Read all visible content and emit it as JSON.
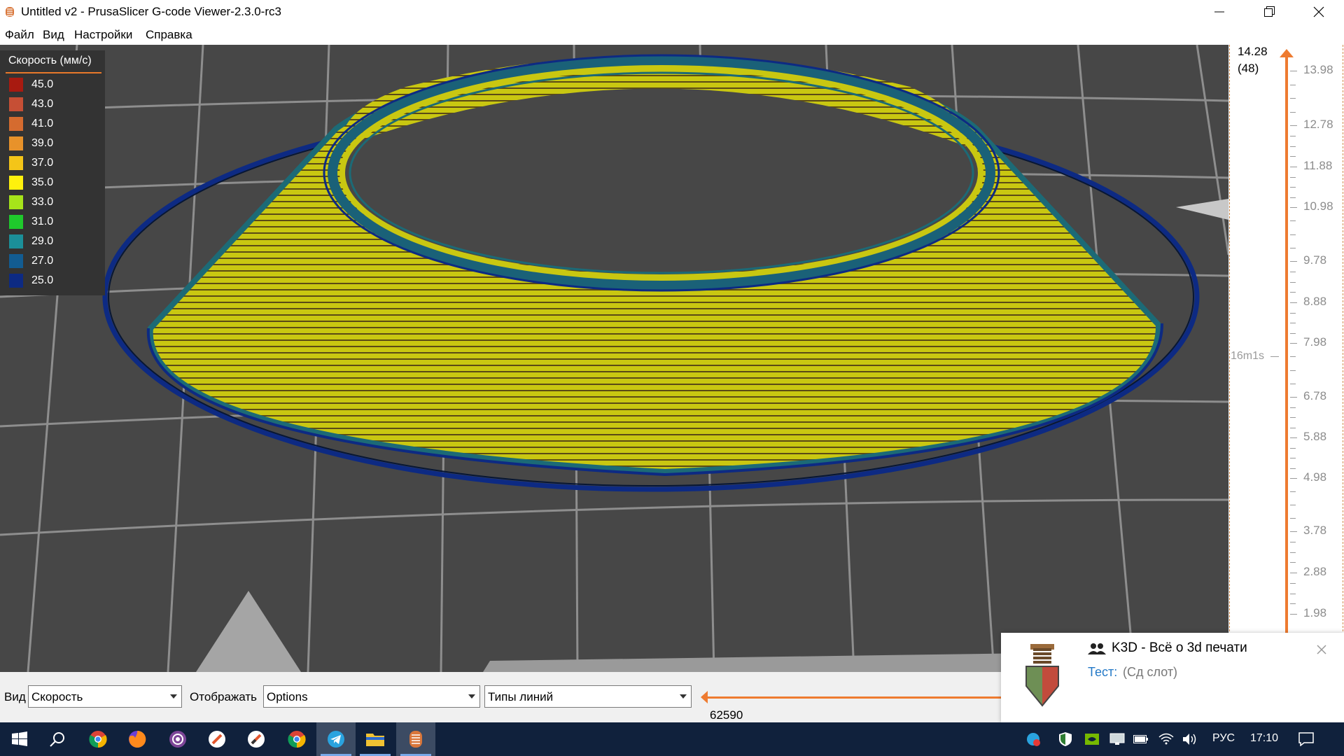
{
  "window": {
    "title": "Untitled v2 - PrusaSlicer G-code Viewer-2.3.0-rc3",
    "controls": [
      "minimize-icon",
      "restore-icon",
      "close-icon"
    ]
  },
  "menu": [
    "Файл",
    "Вид",
    "Настройки",
    "Справка"
  ],
  "legend": {
    "title": "Скорость (мм/с)",
    "items": [
      {
        "label": "45.0",
        "color": "#a81a10"
      },
      {
        "label": "43.0",
        "color": "#c64f35"
      },
      {
        "label": "41.0",
        "color": "#d56b2f"
      },
      {
        "label": "39.0",
        "color": "#e8922a"
      },
      {
        "label": "37.0",
        "color": "#f4c518"
      },
      {
        "label": "35.0",
        "color": "#fff10d"
      },
      {
        "label": "33.0",
        "color": "#a6e41a"
      },
      {
        "label": "31.0",
        "color": "#1fc92c"
      },
      {
        "label": "29.0",
        "color": "#1b8f99"
      },
      {
        "label": "27.0",
        "color": "#125c92"
      },
      {
        "label": "25.0",
        "color": "#0d2a83"
      }
    ]
  },
  "vertical_slider": {
    "top_value": "14.28",
    "top_index": "(48)",
    "estimated_time": "16m1s",
    "ticks": [
      "13.98",
      "12.78",
      "11.88",
      "10.98",
      "9.78",
      "8.88",
      "7.98",
      "6.78",
      "5.88",
      "4.98",
      "3.78",
      "2.88",
      "1.98"
    ]
  },
  "bottom_toolbar": {
    "view_label": "Вид",
    "view_value": "Скорость",
    "show_label": "Отображать",
    "show_value": "Options",
    "line_types_value": "Типы линий",
    "horizontal_slider_value": "62590"
  },
  "notification": {
    "title": "K3D - Всё о 3d печати",
    "body_prefix": "Тест:",
    "body_text": "(Сд слот)"
  },
  "taskbar": {
    "apps": [
      "windows-start-icon",
      "search-icon",
      "chrome-icon",
      "firefox-icon",
      "tor-browser-icon",
      "slicer-icon",
      "slicer-alt-icon",
      "chrome-alt-icon",
      "telegram-icon",
      "file-explorer-icon",
      "prusaslicer-icon"
    ],
    "tray": {
      "language": "РУС",
      "time": "17:10"
    }
  },
  "colors": {
    "viewport_bg": "#474747",
    "accent_orange": "#ee7b30",
    "print_yellow": "#c8c810",
    "skirt_blue": "#0d2a83"
  }
}
